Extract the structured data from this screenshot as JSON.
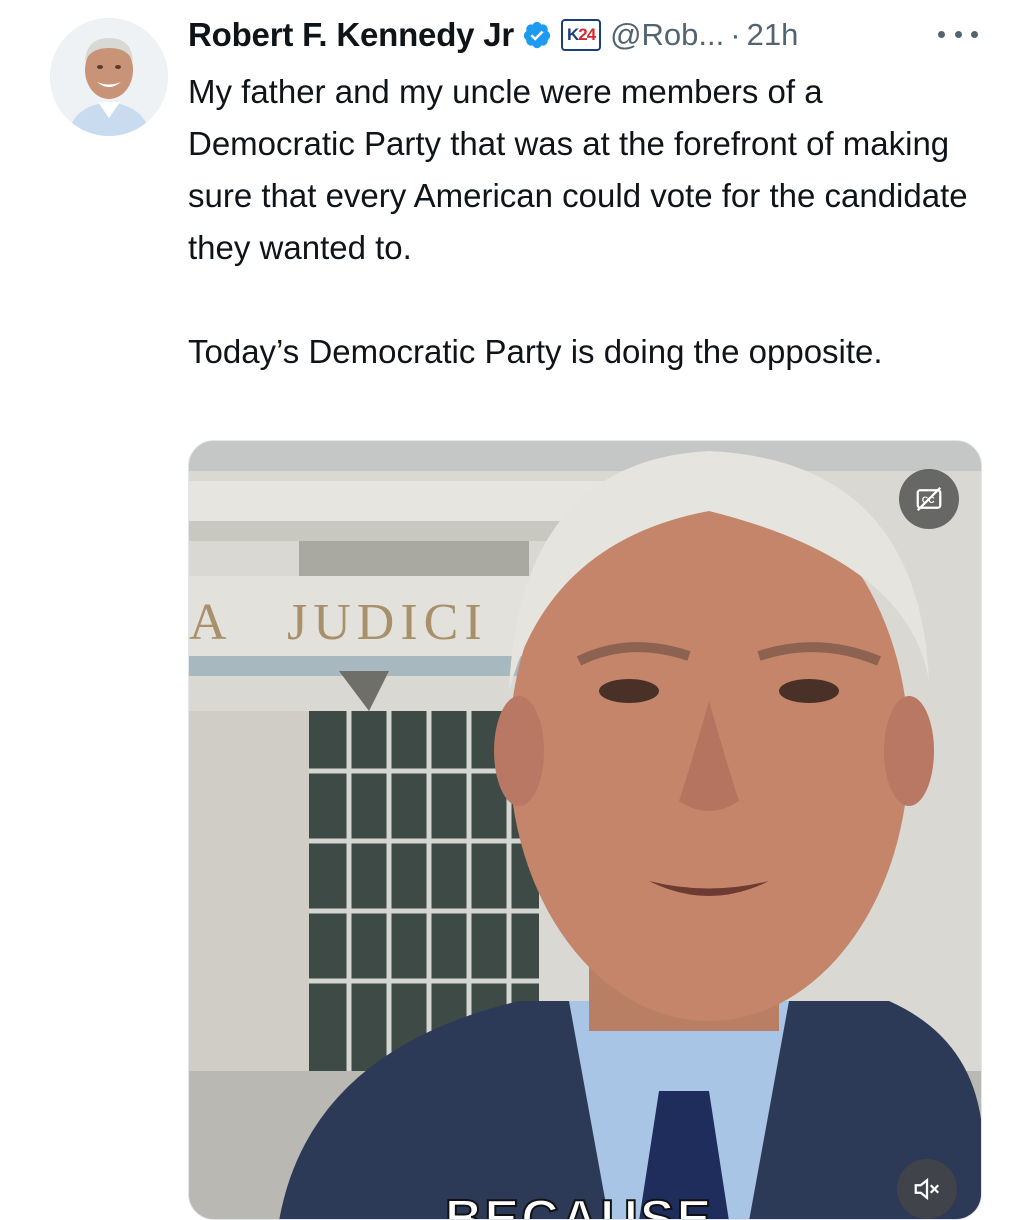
{
  "tweet": {
    "author": {
      "display_name": "Robert F. Kennedy Jr",
      "handle": "@Rob...",
      "verified": true,
      "affiliate_badge": {
        "left": "K",
        "right": "24"
      }
    },
    "separator": "·",
    "timestamp": "21h",
    "text_paragraphs": [
      "My father and my uncle were members of a Democratic Party that was at the forefront of making sure that every American could vote for the candidate they wanted to.",
      "Today’s Democratic Party is doing the opposite."
    ],
    "media": {
      "type": "video",
      "building_sign": "JUDICI",
      "building_sign_partial": "A",
      "caption_partial": "BECAUSE",
      "controls": [
        "closed-captions-icon",
        "muted-speaker-icon"
      ]
    }
  },
  "colors": {
    "verified": "#1d9bf0",
    "text_primary": "#0f1419",
    "text_secondary": "#536471",
    "badge_blue": "#1b3f7a",
    "badge_red": "#d7282f"
  },
  "icons": {
    "more": "ellipsis-icon",
    "verified": "verified-badge-icon",
    "cc": "closed-captions-icon",
    "mute": "muted-speaker-icon"
  }
}
